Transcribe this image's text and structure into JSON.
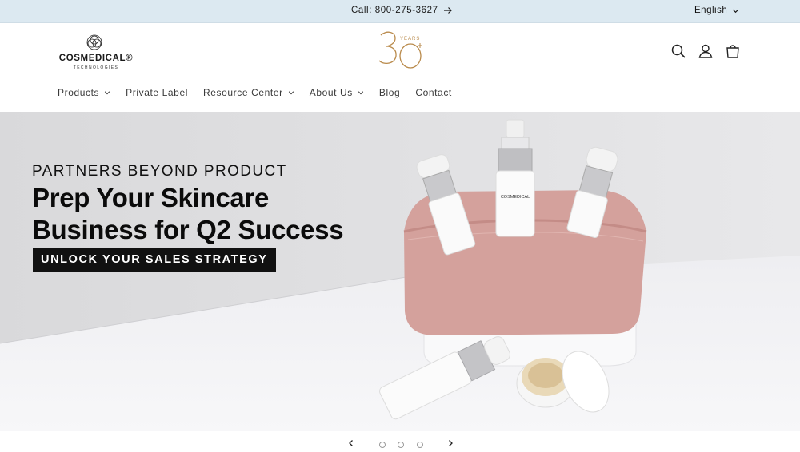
{
  "announcement": {
    "text": "Call: 800-275-3627"
  },
  "language": {
    "selected": "English"
  },
  "logo": {
    "wordmark": "COSMEDICAL®",
    "tagline": "TECHNOLOGIES"
  },
  "emblem": {
    "label": "YEARS",
    "number": "30"
  },
  "header_icons": [
    "search-icon",
    "account-icon",
    "cart-icon"
  ],
  "nav": {
    "items": [
      {
        "label": "Products",
        "has_dropdown": true
      },
      {
        "label": "Private Label",
        "has_dropdown": false
      },
      {
        "label": "Resource Center",
        "has_dropdown": true
      },
      {
        "label": "About Us",
        "has_dropdown": true
      },
      {
        "label": "Blog",
        "has_dropdown": false
      },
      {
        "label": "Contact",
        "has_dropdown": false
      }
    ]
  },
  "hero": {
    "eyebrow": "PARTNERS BEYOND PRODUCT",
    "title_line1": "Prep Your Skincare",
    "title_line2": "Business for Q2 Success",
    "cta": "UNLOCK YOUR SALES STRATEGY",
    "product_brand": "COSMEDICAL"
  },
  "slider": {
    "slide_count": 3,
    "active_index": 0
  },
  "colors": {
    "announcement_bg": "#dce9f1",
    "accent_gold": "#b98a4b",
    "cta_bg": "#111111",
    "bag_pink": "#d4a19c"
  }
}
